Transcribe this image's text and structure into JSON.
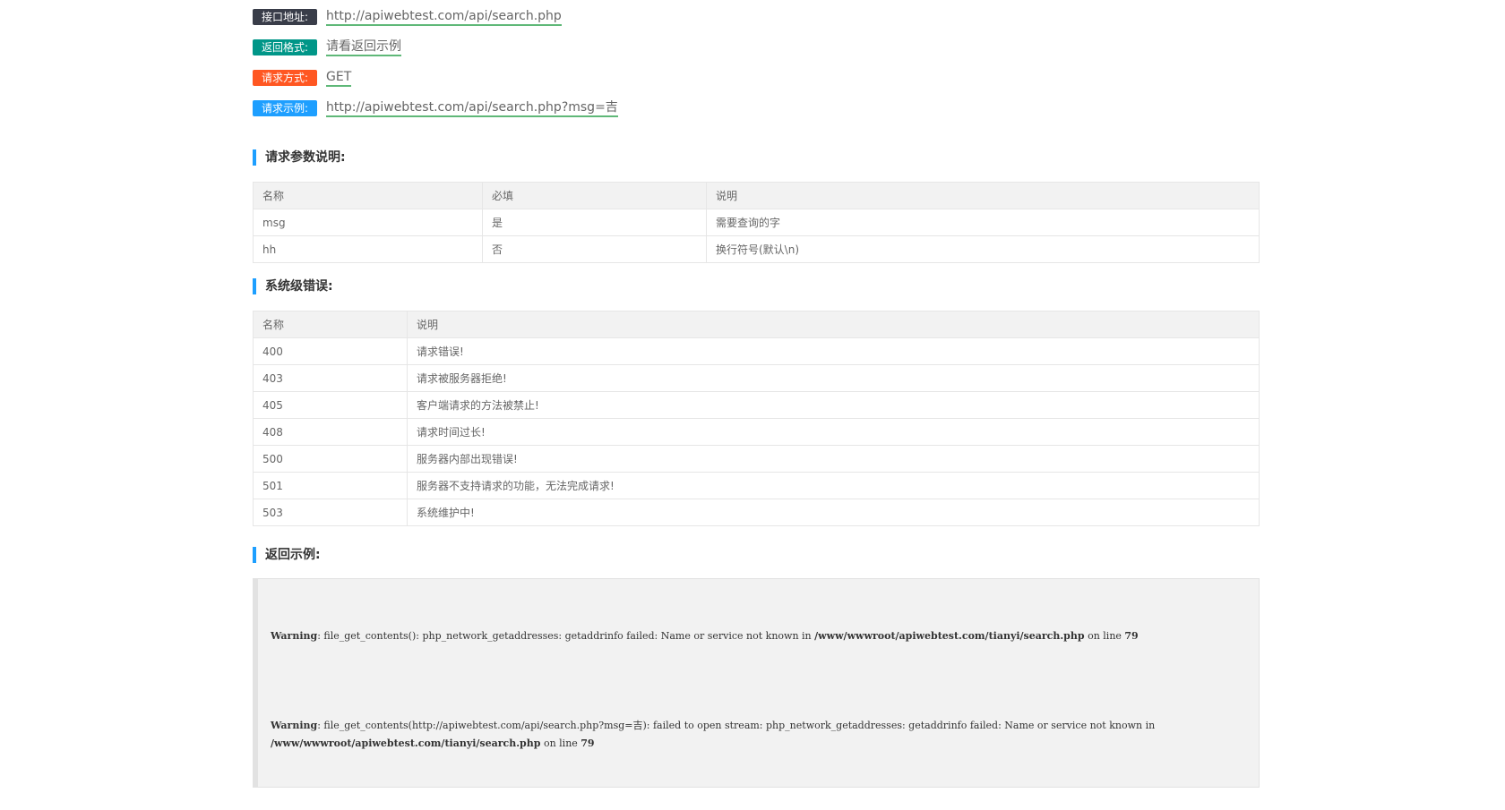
{
  "info": {
    "api_address": {
      "label": "接口地址:",
      "value": "http://apiwebtest.com/api/search.php"
    },
    "return_format": {
      "label": "返回格式:",
      "value": "请看返回示例"
    },
    "method": {
      "label": "请求方式:",
      "value": "GET"
    },
    "example": {
      "label": "请求示例:",
      "value": "http://apiwebtest.com/api/search.php?msg=吉"
    }
  },
  "params_section": {
    "title": "请求参数说明:",
    "headers": [
      "名称",
      "必填",
      "说明"
    ],
    "rows": [
      [
        "msg",
        "是",
        "需要查询的字"
      ],
      [
        "hh",
        "否",
        "换行符号(默认\\n)"
      ]
    ]
  },
  "errors_section": {
    "title": "系统级错误:",
    "headers": [
      "名称",
      "说明"
    ],
    "rows": [
      [
        "400",
        "请求错误!"
      ],
      [
        "403",
        "请求被服务器拒绝!"
      ],
      [
        "405",
        "客户端请求的方法被禁止!"
      ],
      [
        "408",
        "请求时间过长!"
      ],
      [
        "500",
        "服务器内部出现错误!"
      ],
      [
        "501",
        "服务器不支持请求的功能，无法完成请求!"
      ],
      [
        "503",
        "系统维护中!"
      ]
    ]
  },
  "return_section": {
    "title": "返回示例:",
    "warning1": {
      "label": "Warning",
      "text1": ":  file_get_contents(): php_network_getaddresses: getaddrinfo failed: Name or service not known in ",
      "path": "/www/wwwroot/apiwebtest.com/tianyi/search.php",
      "text2": " on line ",
      "line": "79"
    },
    "warning2": {
      "label": "Warning",
      "text1": ":  file_get_contents(http://apiwebtest.com/api/search.php?msg=吉): failed to open stream: php_network_getaddresses: getaddrinfo failed: Name or service not known in ",
      "path": "/www/wwwroot/apiwebtest.com/tianyi/search.php",
      "text2": " on line ",
      "line": "79"
    }
  },
  "colors": {
    "badge_dark": "#393D49",
    "badge_teal": "#009688",
    "badge_orange": "#FF5722",
    "badge_blue": "#1E9FFF",
    "link_underline": "#5FB878",
    "section_accent": "#1E9FFF"
  }
}
